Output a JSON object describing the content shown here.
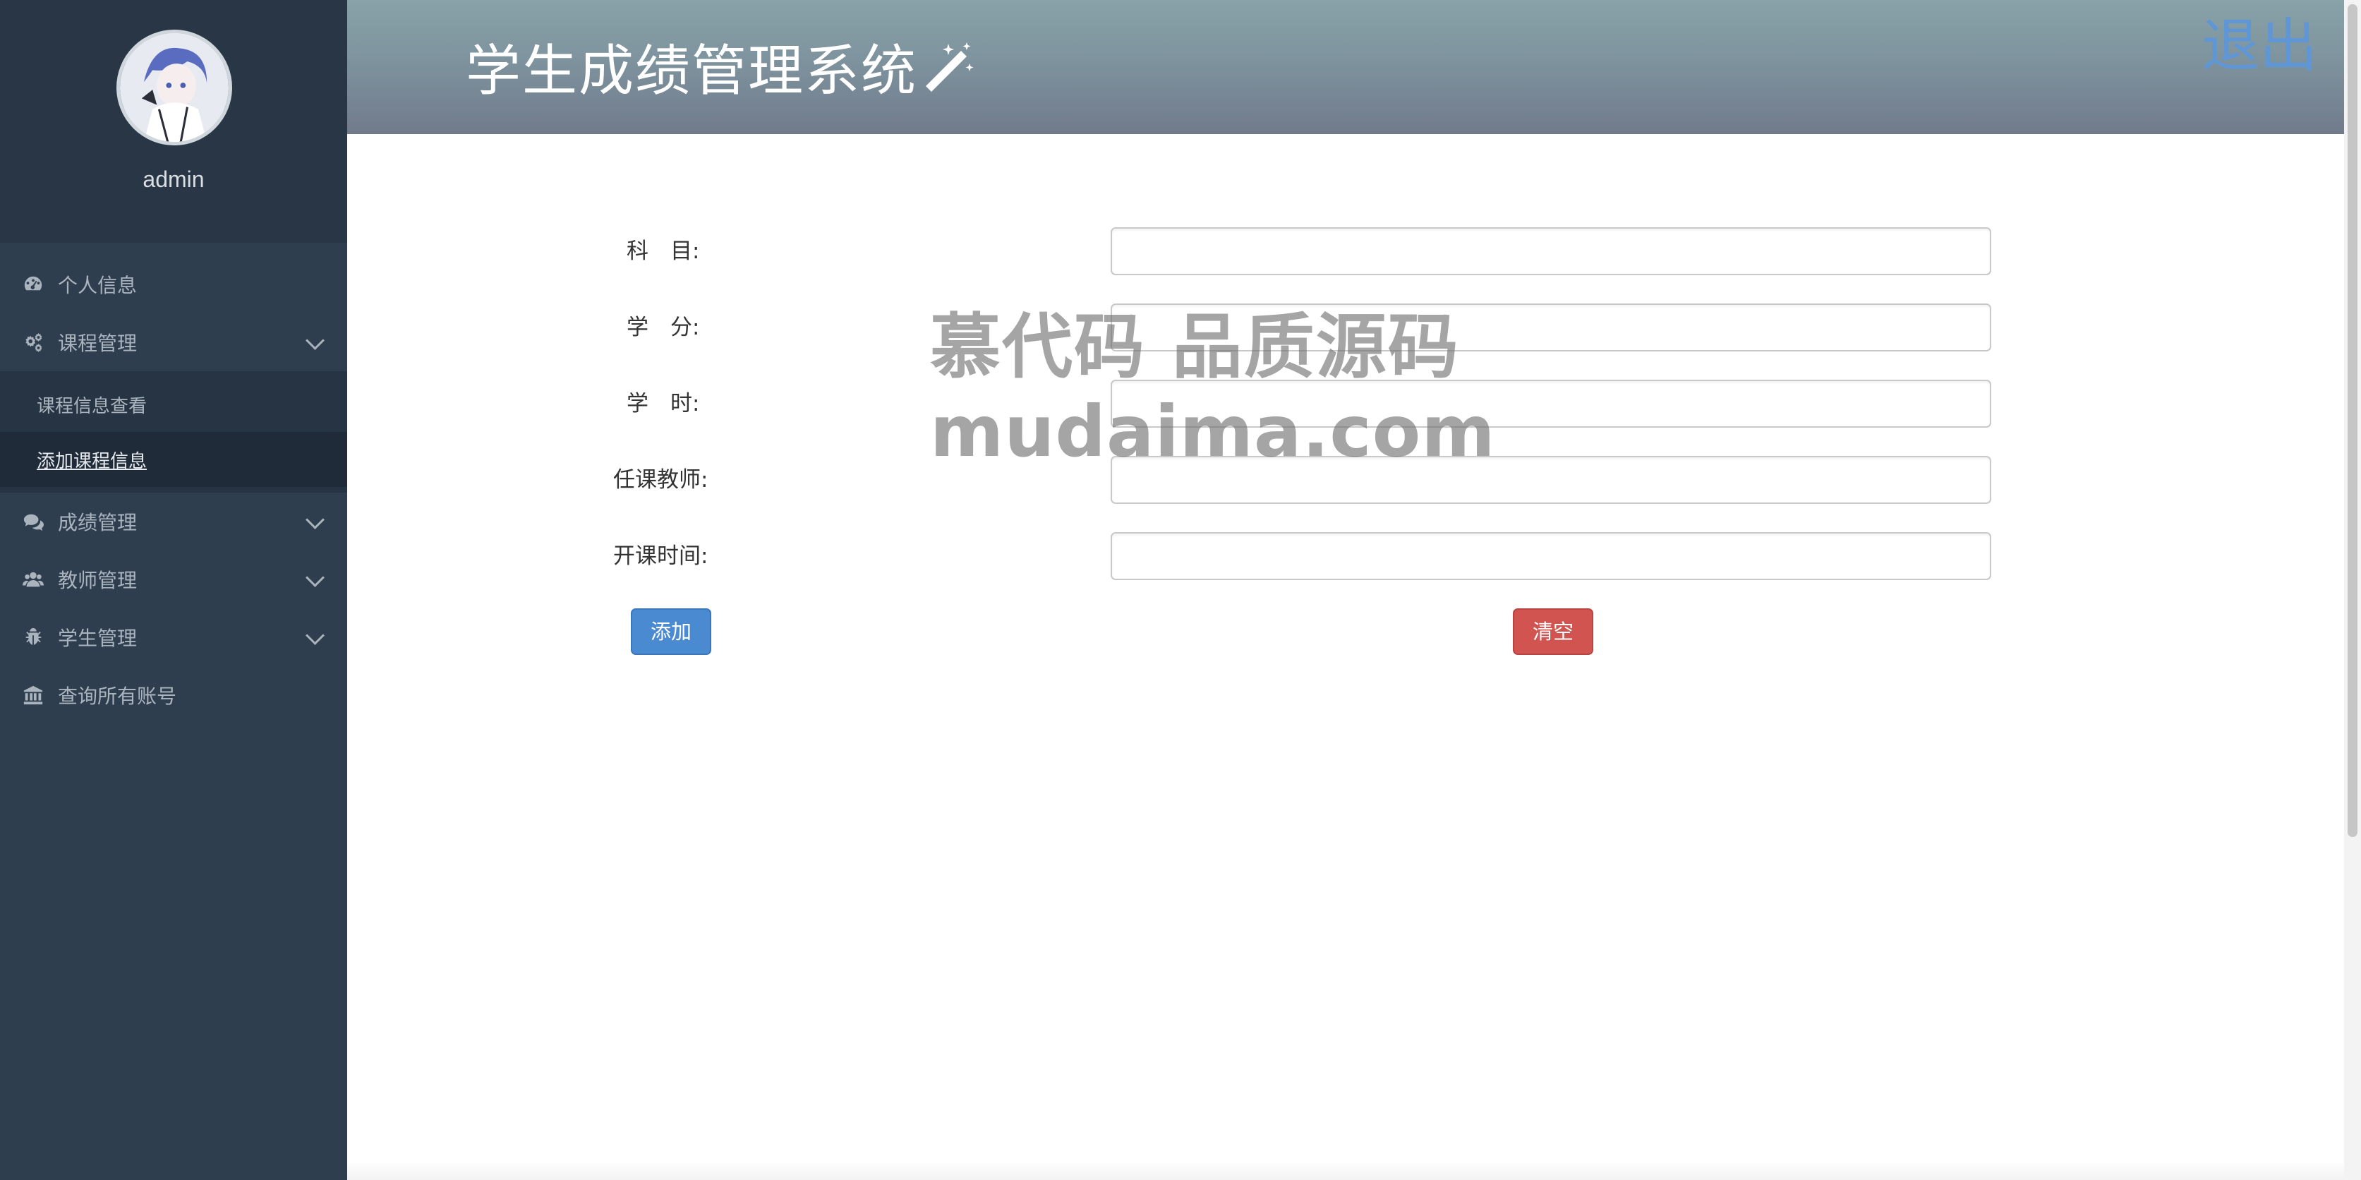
{
  "header": {
    "title": "学生成绩管理系统",
    "logout_label": "退出"
  },
  "sidebar": {
    "username": "admin",
    "items": [
      {
        "label": "个人信息",
        "icon": "dashboard-icon"
      },
      {
        "label": "课程管理",
        "icon": "gears-icon",
        "expanded": true
      },
      {
        "label": "成绩管理",
        "icon": "comments-icon"
      },
      {
        "label": "教师管理",
        "icon": "users-icon"
      },
      {
        "label": "学生管理",
        "icon": "bug-icon"
      },
      {
        "label": "查询所有账号",
        "icon": "bank-icon"
      }
    ],
    "course_submenu": [
      {
        "label": "课程信息查看"
      },
      {
        "label": "添加课程信息",
        "active": true
      }
    ]
  },
  "form": {
    "fields": [
      {
        "label": "科　目:",
        "value": "",
        "placeholder": ""
      },
      {
        "label": "学　分:",
        "value": "",
        "placeholder": ""
      },
      {
        "label": "学　时:",
        "value": "",
        "placeholder": ""
      },
      {
        "label": "任课教师:",
        "value": "",
        "placeholder": ""
      },
      {
        "label": "开课时间:",
        "value": "",
        "placeholder": ""
      }
    ],
    "add_label": "添加",
    "clear_label": "清空"
  },
  "watermark": {
    "line1": "慕代码 品质源码",
    "line2": "mudaima.com"
  },
  "colors": {
    "sidebar_bg": "#2f3e4e",
    "header_accent": "#7e939e",
    "logout": "#5f96d6",
    "add_button": "#4a8ad0",
    "clear_button": "#d15450"
  }
}
